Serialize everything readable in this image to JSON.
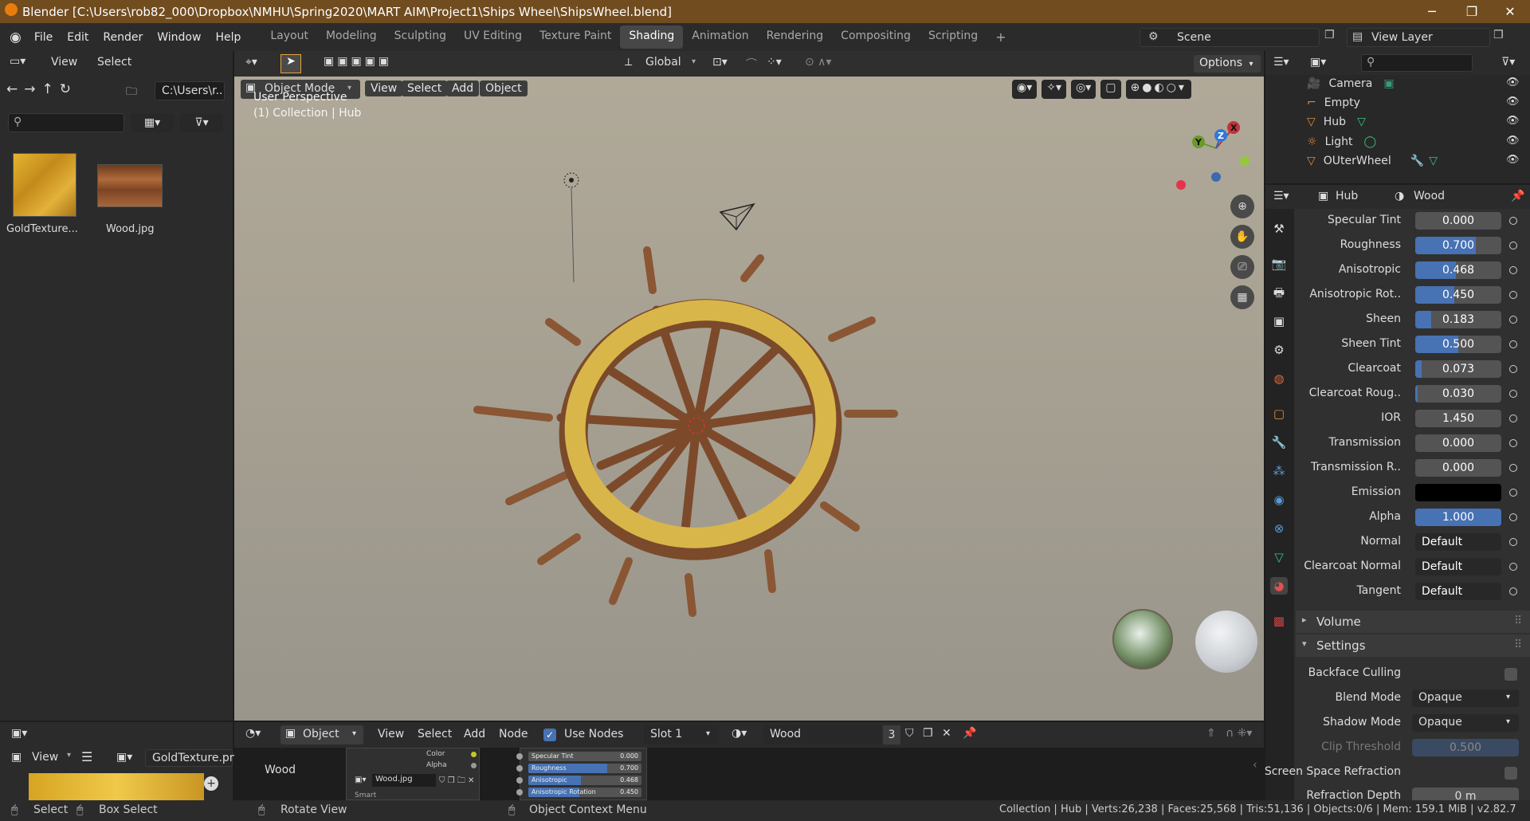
{
  "window": {
    "title": "Blender [C:\\Users\\rob82_000\\Dropbox\\NMHU\\Spring2020\\MART AIM\\Project1\\Ships Wheel\\ShipsWheel.blend]",
    "min": "─",
    "max": "❐",
    "close": "✕"
  },
  "menu": [
    "File",
    "Edit",
    "Render",
    "Window",
    "Help"
  ],
  "workspaces": [
    "Layout",
    "Modeling",
    "Sculpting",
    "UV Editing",
    "Texture Paint",
    "Shading",
    "Animation",
    "Rendering",
    "Compositing",
    "Scripting"
  ],
  "active_workspace": "Shading",
  "scene": "Scene",
  "view_layer": "View Layer",
  "filebrowser": {
    "view": "View",
    "select": "Select",
    "path": "C:\\Users\\r..",
    "files": [
      "GoldTexture...",
      "Wood.jpg"
    ]
  },
  "viewport": {
    "mode": "Object Mode",
    "menus": [
      "View",
      "Select",
      "Add",
      "Object"
    ],
    "orientation": "Global",
    "options": "Options",
    "overlay1": "User Perspective",
    "overlay2": "(1) Collection | Hub",
    "gizmo": {
      "x": "X",
      "y": "Y",
      "z": "Z"
    }
  },
  "outliner": {
    "items": [
      "Camera",
      "Empty",
      "Hub",
      "Light",
      "OUterWheel"
    ]
  },
  "properties": {
    "object": "Hub",
    "material": "Wood",
    "rows": [
      {
        "label": "Specular Tint",
        "value": "0.000",
        "fill": 0
      },
      {
        "label": "Roughness",
        "value": "0.700",
        "fill": 0.7
      },
      {
        "label": "Anisotropic",
        "value": "0.468",
        "fill": 0.468
      },
      {
        "label": "Anisotropic Rot..",
        "value": "0.450",
        "fill": 0.45
      },
      {
        "label": "Sheen",
        "value": "0.183",
        "fill": 0.183
      },
      {
        "label": "Sheen Tint",
        "value": "0.500",
        "fill": 0.5
      },
      {
        "label": "Clearcoat",
        "value": "0.073",
        "fill": 0.073
      },
      {
        "label": "Clearcoat Roug..",
        "value": "0.030",
        "fill": 0.03
      },
      {
        "label": "IOR",
        "value": "1.450",
        "fill": 0
      },
      {
        "label": "Transmission",
        "value": "0.000",
        "fill": 0
      },
      {
        "label": "Transmission R..",
        "value": "0.000",
        "fill": 0
      },
      {
        "label": "Emission",
        "value": "",
        "fill": 0
      },
      {
        "label": "Alpha",
        "value": "1.000",
        "fill": 1
      },
      {
        "label": "Normal",
        "value": "Default",
        "fill": 0
      },
      {
        "label": "Clearcoat Normal",
        "value": "Default",
        "fill": 0
      },
      {
        "label": "Tangent",
        "value": "Default",
        "fill": 0
      }
    ],
    "volume": "Volume",
    "settings": "Settings",
    "backface": "Backface Culling",
    "blend_label": "Blend Mode",
    "blend": "Opaque",
    "shadow_label": "Shadow Mode",
    "shadow": "Opaque",
    "clip_label": "Clip Threshold",
    "clip": "0.500",
    "ssr": "Screen Space Refraction",
    "refr_label": "Refraction Depth",
    "refr": "0 m"
  },
  "node_editor": {
    "object": "Object",
    "menus": [
      "View",
      "Select",
      "Add",
      "Node"
    ],
    "use_nodes": "Use Nodes",
    "slot": "Slot 1",
    "material": "Wood",
    "users": "3",
    "frame_label": "Wood",
    "node_out": [
      "Color",
      "Alpha"
    ],
    "node_img": "Wood.jpg",
    "node_smart": "Smart",
    "bsdf": [
      {
        "label": "Specular Tint",
        "value": "0.000",
        "fill": 0
      },
      {
        "label": "Roughness",
        "value": "0.700",
        "fill": 0.7
      },
      {
        "label": "Anisotropic",
        "value": "0.468",
        "fill": 0.468
      },
      {
        "label": "Anisotropic Rotation",
        "value": "0.450",
        "fill": 0.45
      }
    ]
  },
  "image_editor": {
    "view": "View",
    "image": "GoldTexture.png"
  },
  "statusbar": {
    "select": "Select",
    "box": "Box Select",
    "rotate": "Rotate View",
    "ctx": "Object Context Menu",
    "stats": "Collection | Hub | Verts:26,238 | Faces:25,568 | Tris:51,136 | Objects:0/6 | Mem: 159.1 MiB | v2.82.7"
  },
  "colors": {
    "accent": "#4772b3",
    "title": "#704c1f",
    "active_ws": "#474747"
  }
}
